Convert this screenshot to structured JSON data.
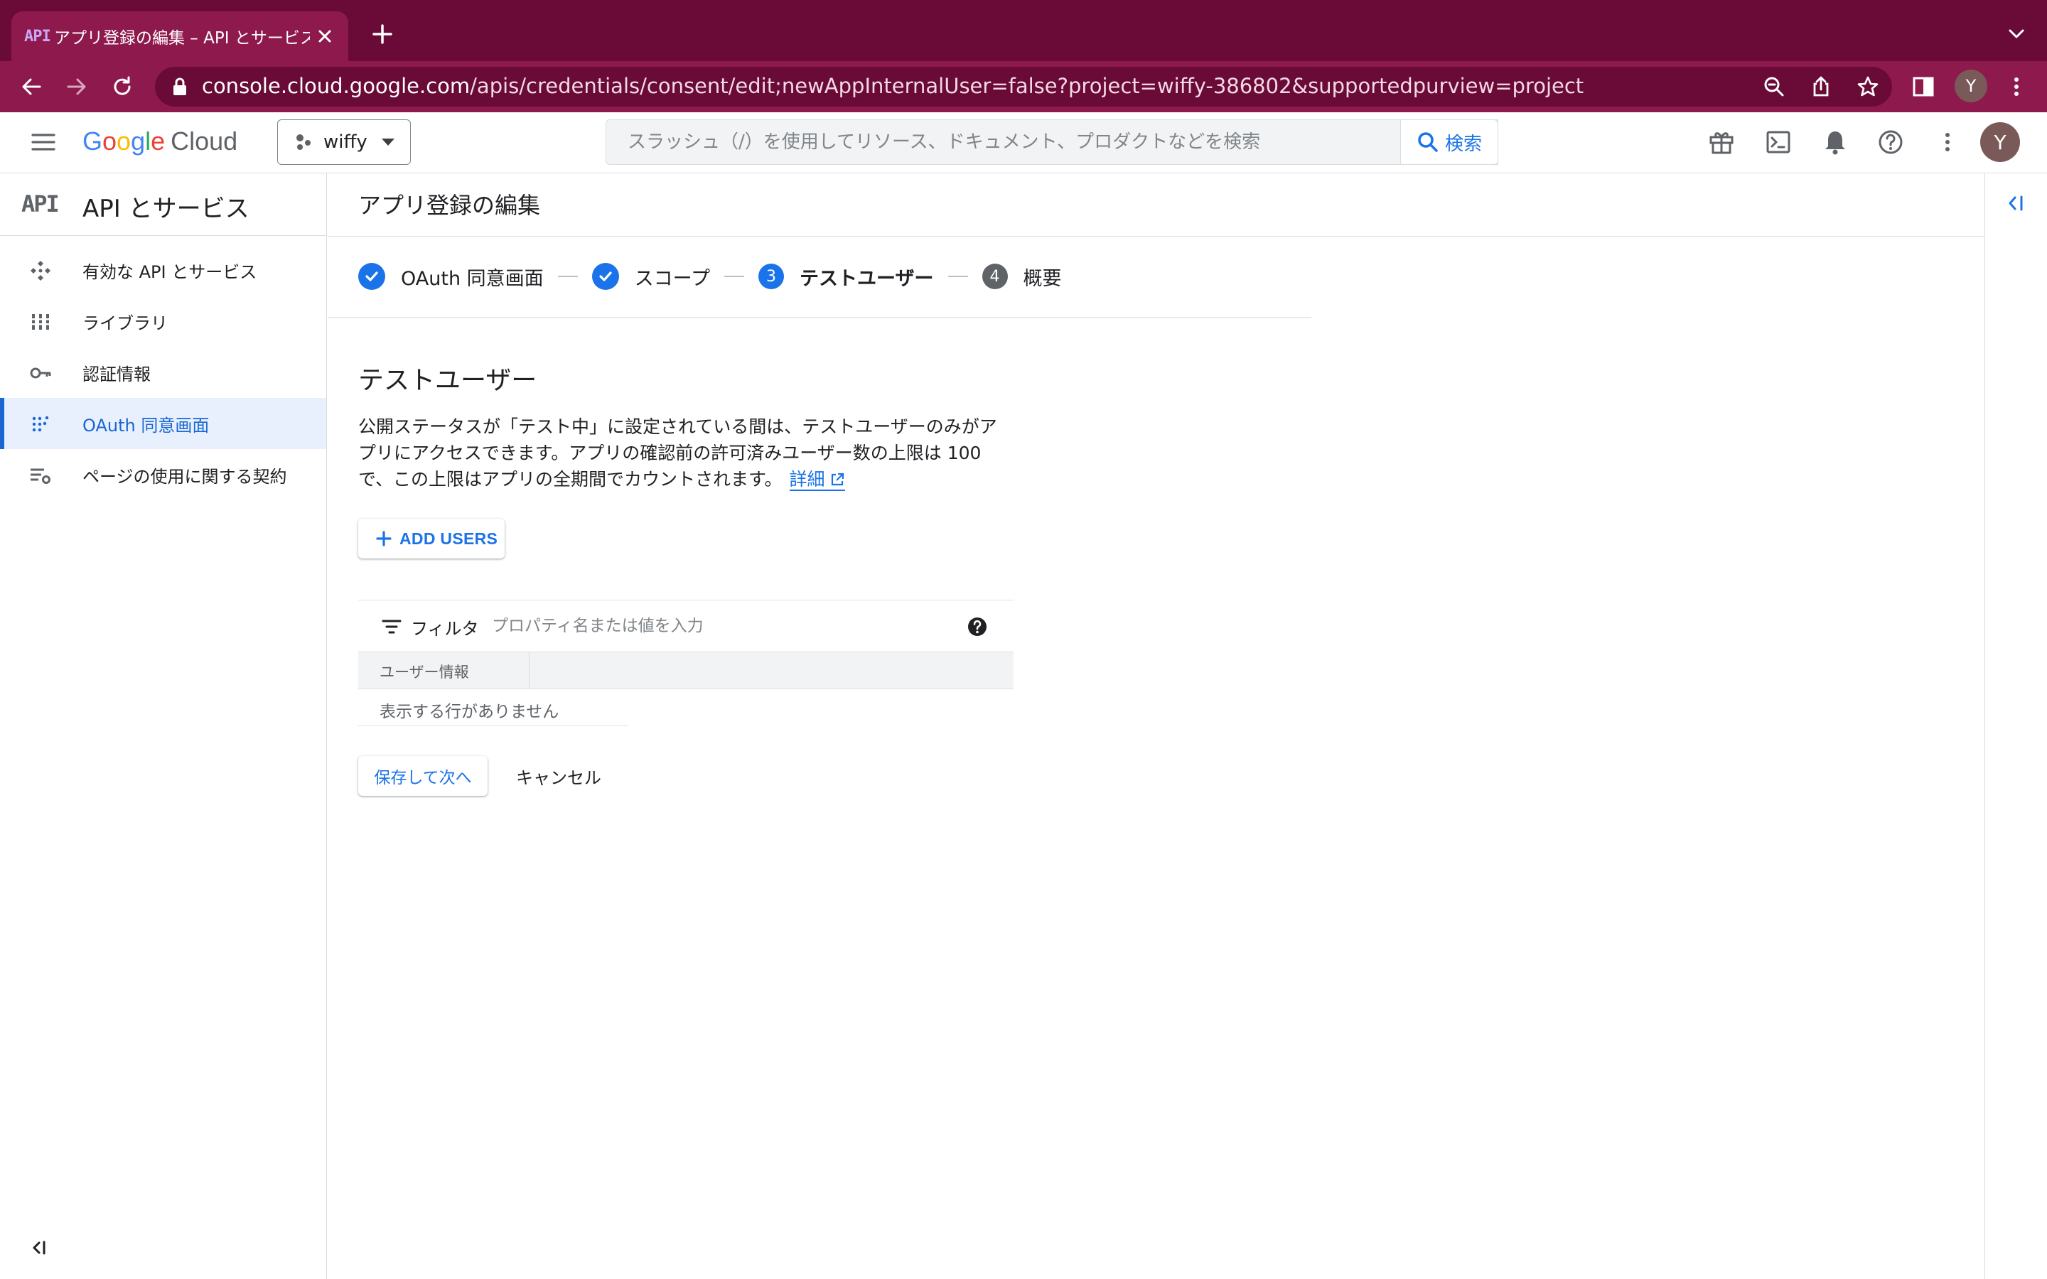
{
  "browser": {
    "tab_favicon": "API",
    "tab_title": "アプリ登録の編集 – API とサービス",
    "url_host": "console.cloud.google.com",
    "url_path": "/apis/credentials/consent/edit;newAppInternalUser=false?project=wiffy-386802&supportedpurview=project",
    "profile_initial": "Y",
    "theme_colors": {
      "tabbar": "#6a0a36",
      "toolbar": "#8e1a4d"
    }
  },
  "header": {
    "logo_letters": [
      "G",
      "o",
      "o",
      "g",
      "l",
      "e"
    ],
    "logo_product": "Cloud",
    "project_name": "wiffy",
    "search_placeholder": "スラッシュ（/）を使用してリソース、ドキュメント、プロダクトなどを検索",
    "search_button": "検索",
    "avatar_initial": "Y",
    "icons": [
      "gift-icon",
      "terminal-icon",
      "bell-icon",
      "help-icon",
      "more-vert-icon"
    ]
  },
  "sidebar": {
    "icon_text": "API",
    "title": "API とサービス",
    "items": [
      {
        "label": "有効な API とサービス",
        "icon": "api-services-icon"
      },
      {
        "label": "ライブラリ",
        "icon": "library-icon"
      },
      {
        "label": "認証情報",
        "icon": "key-icon"
      },
      {
        "label": "OAuth 同意画面",
        "icon": "consent-icon",
        "active": true
      },
      {
        "label": "ページの使用に関する契約",
        "icon": "settings-list-icon"
      }
    ]
  },
  "main": {
    "page_title": "アプリ登録の編集",
    "steps": [
      {
        "label": "OAuth 同意画面",
        "state": "done"
      },
      {
        "label": "スコープ",
        "state": "done"
      },
      {
        "number": "3",
        "label": "テストユーザー",
        "state": "current"
      },
      {
        "number": "4",
        "label": "概要",
        "state": "todo"
      }
    ],
    "section_title": "テストユーザー",
    "description": "公開ステータスが「テスト中」に設定されている間は、テストユーザーのみがアプリにアクセスできます。アプリの確認前の許可済みユーザー数の上限は 100 で、この上限はアプリの全期間でカウントされます。",
    "learn_more_link": "詳細",
    "add_users_button": "ADD USERS",
    "filter": {
      "label": "フィルタ",
      "placeholder": "プロパティ名または値を入力"
    },
    "table": {
      "columns": [
        "ユーザー情報"
      ],
      "empty_message": "表示する行がありません"
    },
    "save_button": "保存して次へ",
    "cancel_button": "キャンセル"
  },
  "colors": {
    "accent": "#1a73e8",
    "active_bg": "#e8f0fe",
    "step_todo": "#5f6368"
  }
}
